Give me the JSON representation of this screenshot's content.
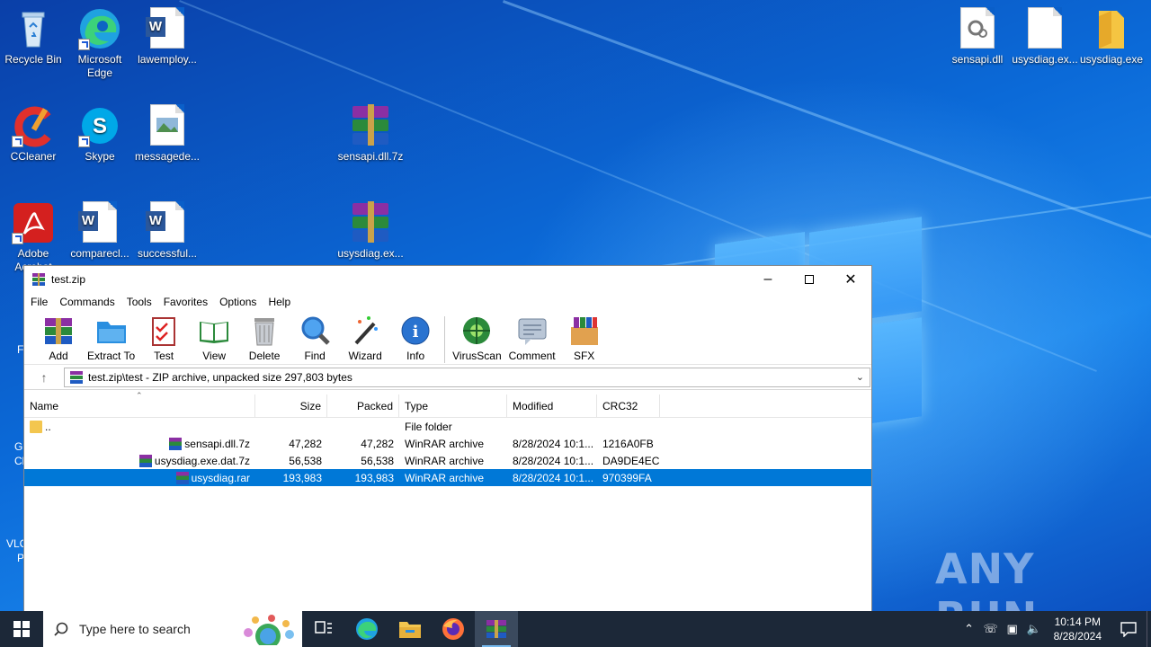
{
  "desktop": {
    "icons_left": [
      {
        "label": "Recycle Bin",
        "icon": "recycle-bin-icon"
      },
      {
        "label": "Microsoft Edge",
        "icon": "edge-icon"
      },
      {
        "label": "lawemploy...",
        "icon": "word-doc-icon"
      },
      {
        "label": "CCleaner",
        "icon": "ccleaner-icon"
      },
      {
        "label": "Skype",
        "icon": "skype-icon"
      },
      {
        "label": "messagede...",
        "icon": "image-file-icon"
      },
      {
        "label": "sensapi.dll.7z",
        "icon": "winrar-archive-icon"
      },
      {
        "label": "Adobe Acrobat",
        "icon": "acrobat-icon"
      },
      {
        "label": "comparecl...",
        "icon": "word-doc-icon"
      },
      {
        "label": "successful...",
        "icon": "word-doc-icon"
      },
      {
        "label": "usysdiag.ex...",
        "icon": "winrar-archive-icon"
      }
    ],
    "icons_right": [
      {
        "label": "sensapi.dll",
        "icon": "dll-file-icon"
      },
      {
        "label": "usysdiag.ex...",
        "icon": "blank-file-icon"
      },
      {
        "label": "usysdiag.exe",
        "icon": "folder-icon"
      }
    ],
    "partial_labels": [
      "F",
      "G",
      "Cl",
      "VLC",
      "P"
    ],
    "watermark": "ANY RUN"
  },
  "window": {
    "title": "test.zip",
    "menu": [
      "File",
      "Commands",
      "Tools",
      "Favorites",
      "Options",
      "Help"
    ],
    "toolbar": [
      "Add",
      "Extract To",
      "Test",
      "View",
      "Delete",
      "Find",
      "Wizard",
      "Info",
      "VirusScan",
      "Comment",
      "SFX"
    ],
    "address": "test.zip\\test - ZIP archive, unpacked size 297,803 bytes",
    "columns": [
      "Name",
      "Size",
      "Packed",
      "Type",
      "Modified",
      "CRC32"
    ],
    "rows": [
      {
        "name": "..",
        "size": "",
        "packed": "",
        "type": "File folder",
        "modified": "",
        "crc": "",
        "kind": "folder",
        "selected": false
      },
      {
        "name": "sensapi.dll.7z",
        "size": "47,282",
        "packed": "47,282",
        "type": "WinRAR archive",
        "modified": "8/28/2024 10:1...",
        "crc": "1216A0FB",
        "kind": "rar",
        "selected": false
      },
      {
        "name": "usysdiag.exe.dat.7z",
        "size": "56,538",
        "packed": "56,538",
        "type": "WinRAR archive",
        "modified": "8/28/2024 10:1...",
        "crc": "DA9DE4EC",
        "kind": "rar",
        "selected": false
      },
      {
        "name": "usysdiag.rar",
        "size": "193,983",
        "packed": "193,983",
        "type": "WinRAR archive",
        "modified": "8/28/2024 10:1...",
        "crc": "970399FA",
        "kind": "rar",
        "selected": true
      }
    ]
  },
  "taskbar": {
    "search_placeholder": "Type here to search",
    "time": "10:14 PM",
    "date": "8/28/2024"
  },
  "colors": {
    "selection": "#0078d7",
    "taskbar": "#1c2838"
  }
}
